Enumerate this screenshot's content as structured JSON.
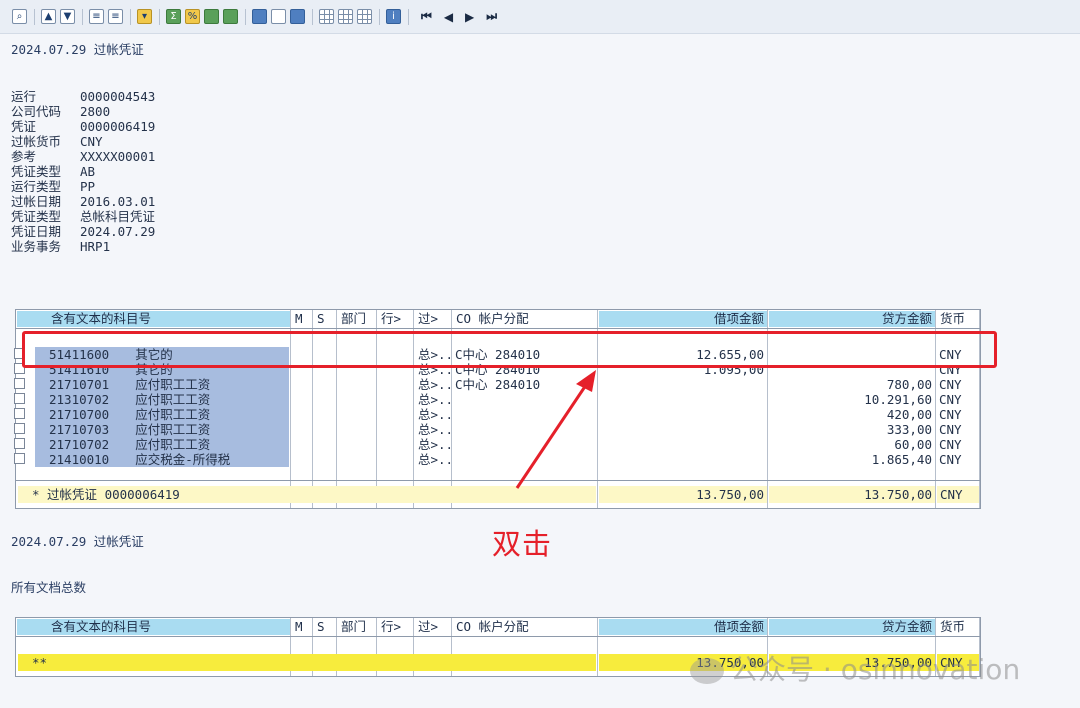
{
  "toolbar": {
    "groups": [
      [
        "magnifier-icon"
      ],
      [
        "sort-ascending-icon",
        "sort-descending-icon"
      ],
      [
        "align-up-icon",
        "align-down-icon"
      ],
      [
        "filter-icon"
      ],
      [
        "sum-icon",
        "subtotal-icon",
        "layout-select-icon",
        "layout-save-icon"
      ],
      [
        "export-icon",
        "print-preview-icon",
        "abc-analysis-icon"
      ],
      [
        "grid-icon",
        "columns-icon",
        "freeze-icon"
      ],
      [
        "info-icon"
      ]
    ],
    "nav": [
      "⏮",
      "◀",
      "▶",
      "⏭"
    ]
  },
  "report_title": "2024.07.29 过帐凭证",
  "header_fields": [
    {
      "label": "运行",
      "value": "0000004543"
    },
    {
      "label": "公司代码",
      "value": "2800"
    },
    {
      "label": "凭证",
      "value": "0000006419"
    },
    {
      "label": "过帐货币",
      "value": "CNY"
    },
    {
      "label": "参考",
      "value": "XXXXX00001"
    },
    {
      "label": "凭证类型",
      "value": "AB"
    },
    {
      "label": "运行类型",
      "value": "PP"
    },
    {
      "label": "过帐日期",
      "value": "2016.03.01"
    },
    {
      "label": "凭证类型",
      "value": "总帐科目凭证"
    },
    {
      "label": "凭证日期",
      "value": "2024.07.29"
    },
    {
      "label": "业务事务",
      "value": "HRP1"
    }
  ],
  "grid1": {
    "headers": {
      "account": "含有文本的科目号",
      "m": "M",
      "s": "S",
      "dept": "部门",
      "line": "行>",
      "post": "过>",
      "co": "CO 帐户分配",
      "debit": "借项金额",
      "credit": "贷方金额",
      "currency": "货币"
    },
    "rows": [
      {
        "account": "51411600",
        "text": "其它的",
        "post": "总>...",
        "co": "C中心 284010",
        "debit": "12.655,00",
        "credit": "",
        "currency": "CNY"
      },
      {
        "account": "51411610",
        "text": "其它的",
        "post": "总>...",
        "co": "C中心 284010",
        "debit": "1.095,00",
        "credit": "",
        "currency": "CNY"
      },
      {
        "account": "21710701",
        "text": "应付职工工资",
        "post": "总>...",
        "co": "C中心 284010",
        "debit": "",
        "credit": "780,00",
        "currency": "CNY"
      },
      {
        "account": "21310702",
        "text": "应付职工工资",
        "post": "总>...",
        "co": "",
        "debit": "",
        "credit": "10.291,60",
        "currency": "CNY"
      },
      {
        "account": "21710700",
        "text": "应付职工工资",
        "post": "总>...",
        "co": "",
        "debit": "",
        "credit": "420,00",
        "currency": "CNY"
      },
      {
        "account": "21710703",
        "text": "应付职工工资",
        "post": "总>...",
        "co": "",
        "debit": "",
        "credit": "333,00",
        "currency": "CNY"
      },
      {
        "account": "21710702",
        "text": "应付职工工资",
        "post": "总>...",
        "co": "",
        "debit": "",
        "credit": "60,00",
        "currency": "CNY"
      },
      {
        "account": "21410010",
        "text": "应交税金-所得税",
        "post": "总>...",
        "co": "",
        "debit": "",
        "credit": "1.865,40",
        "currency": "CNY"
      }
    ],
    "total": {
      "label": "* 过帐凭证 0000006419",
      "debit": "13.750,00",
      "credit": "13.750,00",
      "currency": "CNY"
    }
  },
  "annotation": "双击",
  "report_title_2": "2024.07.29 过帐凭证",
  "all_docs_title": "所有文档总数",
  "grid2": {
    "total": {
      "label": "**",
      "debit": "13.750,00",
      "credit": "13.750,00",
      "currency": "CNY"
    }
  },
  "watermark": "公众号 · osinnovation",
  "colors": {
    "highlight": "#e5202a",
    "header_blue": "#a9dcf1",
    "account_bg": "#a7bcdf",
    "total_yellow": "#fdf8c6",
    "grand_total_yellow": "#f7ec3d"
  }
}
